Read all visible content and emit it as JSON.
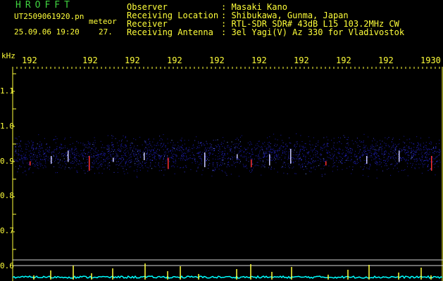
{
  "header": {
    "logo": "HROFFT",
    "filename": "UT2509061920.pn",
    "meteor_label": "meteor",
    "datetime": "25.09.06 19:20",
    "meta_number": "27."
  },
  "station": [
    {
      "key": "Observer",
      "value": ": Masaki Kano"
    },
    {
      "key": "Receiving Location",
      "value": ": Shibukawa, Gunma, Japan"
    },
    {
      "key": "Receiver",
      "value": ": RTL-SDR SDR# 43dB L15 103.2MHz CW"
    },
    {
      "key": "Receiving Antenna",
      "value": ": 3el Yagi(V) Az 330 for Vladivostok"
    }
  ],
  "chart_data": {
    "type": "heatmap",
    "ylabel": "kHz",
    "y_ticks": [
      "1.1",
      "1.0",
      "0.9",
      "0.8",
      "0.7",
      "0.6"
    ],
    "x_ticks": [
      "192",
      "192",
      "192",
      "192",
      "192",
      "192",
      "192",
      "192",
      "192",
      "1930"
    ],
    "band_khz": [
      0.85,
      0.99
    ],
    "ylim": [
      0.6,
      1.1
    ],
    "colors": {
      "background": "#000000",
      "axis": "#ffff3a",
      "noise": "#1a1aa8",
      "echo": "#ff3030",
      "trace": "#00ffff"
    }
  }
}
